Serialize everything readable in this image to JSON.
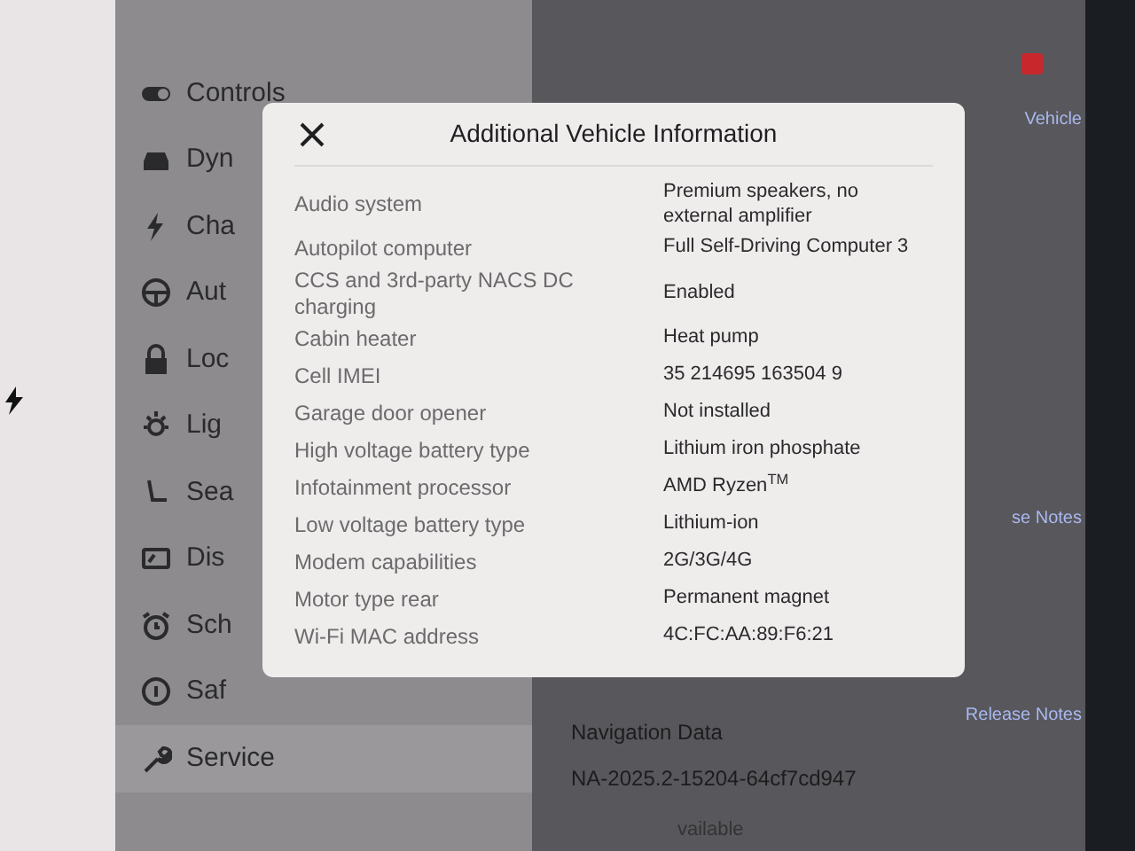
{
  "sidebar": {
    "items": [
      {
        "label": "Controls",
        "selected": false
      },
      {
        "label": "Dyn",
        "selected": false
      },
      {
        "label": "Cha",
        "selected": false
      },
      {
        "label": "Aut",
        "selected": false
      },
      {
        "label": "Loc",
        "selected": false
      },
      {
        "label": "Lig",
        "selected": false
      },
      {
        "label": "Sea",
        "selected": false
      },
      {
        "label": "Dis",
        "selected": false
      },
      {
        "label": "Sch",
        "selected": false
      },
      {
        "label": "Saf",
        "selected": false
      },
      {
        "label": "Service",
        "selected": true
      }
    ]
  },
  "links": [
    "Vehicle",
    "se Notes",
    "Release Notes"
  ],
  "navigation_data": {
    "label": "Navigation Data",
    "value": "NA-2025.2-15204-64cf7cd947"
  },
  "footer_text": "vailable",
  "dialog": {
    "title": "Additional Vehicle Information",
    "rows": [
      {
        "label": "Audio system",
        "value": "Premium speakers, no external amplifier"
      },
      {
        "label": "Autopilot computer",
        "value": "Full Self-Driving Computer 3"
      },
      {
        "label": "CCS and 3rd-party NACS DC charging",
        "value": "Enabled"
      },
      {
        "label": "Cabin heater",
        "value": "Heat pump"
      },
      {
        "label": "Cell IMEI",
        "value": "35 214695 163504 9"
      },
      {
        "label": "Garage door opener",
        "value": "Not installed"
      },
      {
        "label": "High voltage battery type",
        "value": "Lithium iron phosphate"
      },
      {
        "label": "Infotainment processor",
        "value": "AMD Ryzen$^{TM}$"
      },
      {
        "label": "Low voltage battery type",
        "value": "Lithium-ion"
      },
      {
        "label": "Modem capabilities",
        "value": "2G/3G/4G"
      },
      {
        "label": "Motor type rear",
        "value": "Permanent magnet"
      },
      {
        "label": "Wi-Fi MAC address",
        "value": "4C:FC:AA:89:F6:21"
      }
    ]
  }
}
